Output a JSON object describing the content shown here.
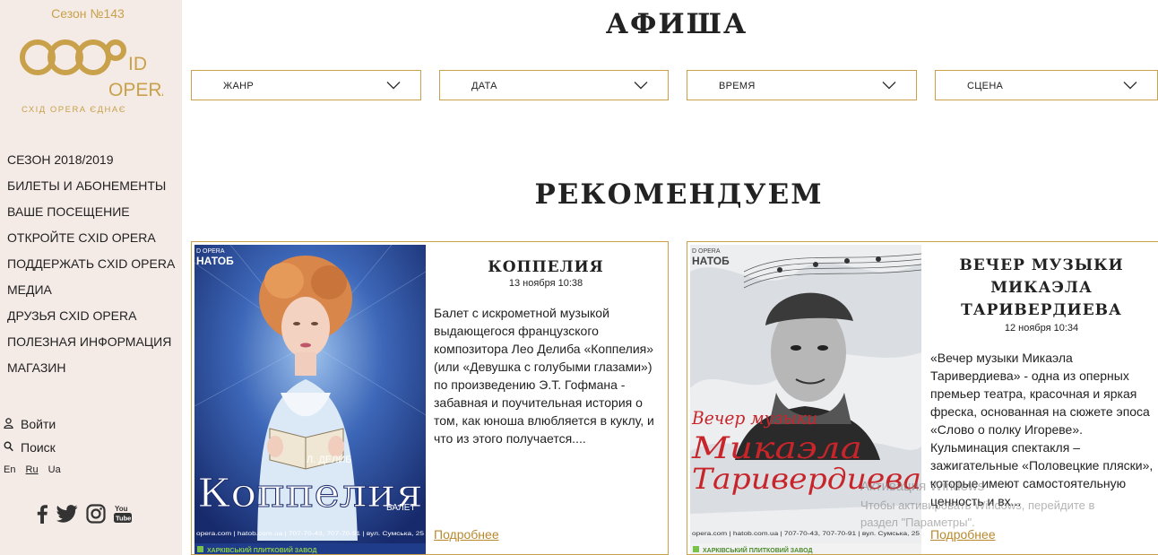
{
  "sidebar": {
    "season": "Сезон №143",
    "logo": {
      "line1": "ID",
      "line2": "OPERA",
      "tagline": "СХІД OPERA ЄДНАЄ"
    },
    "menu": [
      "СЕЗОН 2018/2019",
      "БИЛЕТЫ И АБОНЕМЕНТЫ",
      "ВАШЕ ПОСЕЩЕНИЕ",
      "ОТКРОЙТЕ CXID OPERA",
      "ПОДДЕРЖАТЬ CXID OPERA",
      "МЕДИА",
      "ДРУЗЬЯ CXID OPERA",
      "ПОЛЕЗНАЯ ИНФОРМАЦИЯ",
      "МАГАЗИН"
    ],
    "login": "Войти",
    "search": "Поиск",
    "languages": [
      "En",
      "Ru",
      "Ua"
    ],
    "social": [
      "facebook-icon",
      "twitter-icon",
      "instagram-icon",
      "youtube-icon"
    ]
  },
  "afisha": {
    "title": "АФИША",
    "filters": [
      "ЖАНР",
      "ДАТА",
      "ВРЕМЯ",
      "СЦЕНА"
    ]
  },
  "recommend": {
    "title": "РЕКОМЕНДУЕМ",
    "cards": [
      {
        "title": "КОППЕЛИЯ",
        "date": "13 ноября 10:38",
        "desc_lines": [
          "Балет с искрометной музыкой",
          "выдающегося французского",
          "композитора Лео Делиба «Коппелия»",
          "(или «Девушка с голубыми глазами»)",
          "по произведению Э.Т. Гофмана -",
          "забавная и поучительная история о",
          "том, как юноша влюбляется в куклу, и",
          "что из этого получается...."
        ],
        "more": "Подробнее",
        "poster": {
          "brand": "D OPERA",
          "org": "НАТОБ",
          "author": "Л. ДЕЛИБ",
          "word": "Коппелия",
          "genre": "БАЛЕТ",
          "footer": "opera.com  |  hatob.com.ua  |  707-70-43, 707-70-91  |  вул. Сумська, 25",
          "sponsor": "ХАРКІВСЬКИЙ ПЛИТКОВИЙ ЗАВОД"
        }
      },
      {
        "title_lines": [
          "ВЕЧЕР МУЗЫКИ",
          "МИКАЭЛА",
          "ТАРИВЕРДИЕВА"
        ],
        "date": "12 ноября 10:34",
        "desc_lines": [
          "«Вечер музыки Микаэла",
          "Таривердиева» - одна из оперных",
          "премьер театра, красочная и яркая",
          "фреска, основанная на сюжете эпоса",
          "«Слово о полку Игореве».",
          "Кульминация спектакля –",
          "зажигательные «Половецкие пляски»,",
          "которые имеют самостоятельную",
          "ценность и вх..."
        ],
        "more": "Подробнее",
        "poster": {
          "brand": "D OPERA",
          "org": "НАТОБ",
          "line1": "Вечер музыки",
          "line2": "Микаэла",
          "line3": "Таривердиева",
          "footer": "opera.com  |  hatob.com.ua  |  707-70-43, 707-70-91  |  вул. Сумська, 25",
          "sponsor": "ХАРКІВСЬКИЙ ПЛИТКОВИЙ ЗАВОД"
        }
      }
    ]
  },
  "watermark": {
    "line1": "Активация Windows",
    "line2": "Чтобы активировать Windows, перейдите в",
    "line3": "раздел \"Параметры\"."
  },
  "colors": {
    "accent": "#c9a14a",
    "sidebar_bg": "#f4ebe7",
    "text": "#222222"
  }
}
